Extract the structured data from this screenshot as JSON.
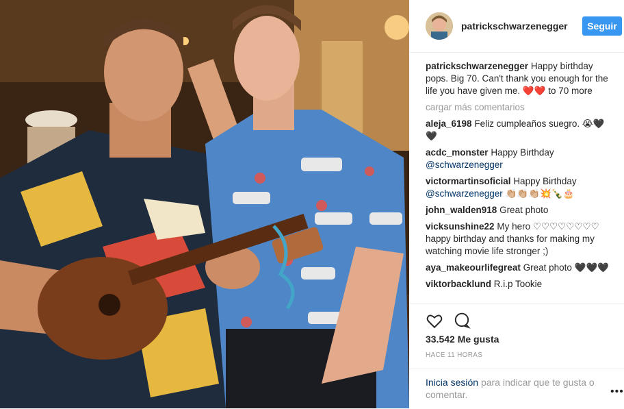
{
  "header": {
    "username": "patrickschwarzenegger",
    "follow_label": "Seguir"
  },
  "caption": {
    "user": "patrickschwarzenegger",
    "text": "Happy birthday pops. Big 70. Can't thank you enough for the life you have given me.",
    "hearts": "❤️❤️",
    "tail": "to 70 more"
  },
  "load_more": "cargar más comentarios",
  "comments": [
    {
      "user": "aleja_6198",
      "text": "Feliz cumpleaños suegro. 😭🖤🖤"
    },
    {
      "user": "acdc_monster",
      "text": "Happy Birthday",
      "mention": "@schwarzenegger"
    },
    {
      "user": "victormartinsoficial",
      "text": "Happy Birthday",
      "mention": "@schwarzenegger",
      "emoji": "👏🏼👏🏼👏🏼💥🍾🎂"
    },
    {
      "user": "john_walden918",
      "text": "Great photo"
    },
    {
      "user": "vicksunshine22",
      "text": "My hero ♡♡♡♡♡♡♡♡ happy birthday and thanks for making my watching movie life stronger ;)"
    },
    {
      "user": "aya_makeourlifegreat",
      "text": "Great photo 🖤🖤🖤"
    },
    {
      "user": "viktorbacklund",
      "text": "R.i.p Tookie"
    }
  ],
  "actions": {
    "like_icon": "heart-outline-icon",
    "comment_icon": "comment-bubble-icon"
  },
  "likes": "33.542 Me gusta",
  "time": "HACE 11 HORAS",
  "login": {
    "link": "Inicia sesión",
    "rest": "para indicar que te gusta o comentar."
  },
  "more_icon": "more-options-icon",
  "colors": {
    "accent": "#3897f0",
    "link": "#003569",
    "muted": "#999999"
  }
}
